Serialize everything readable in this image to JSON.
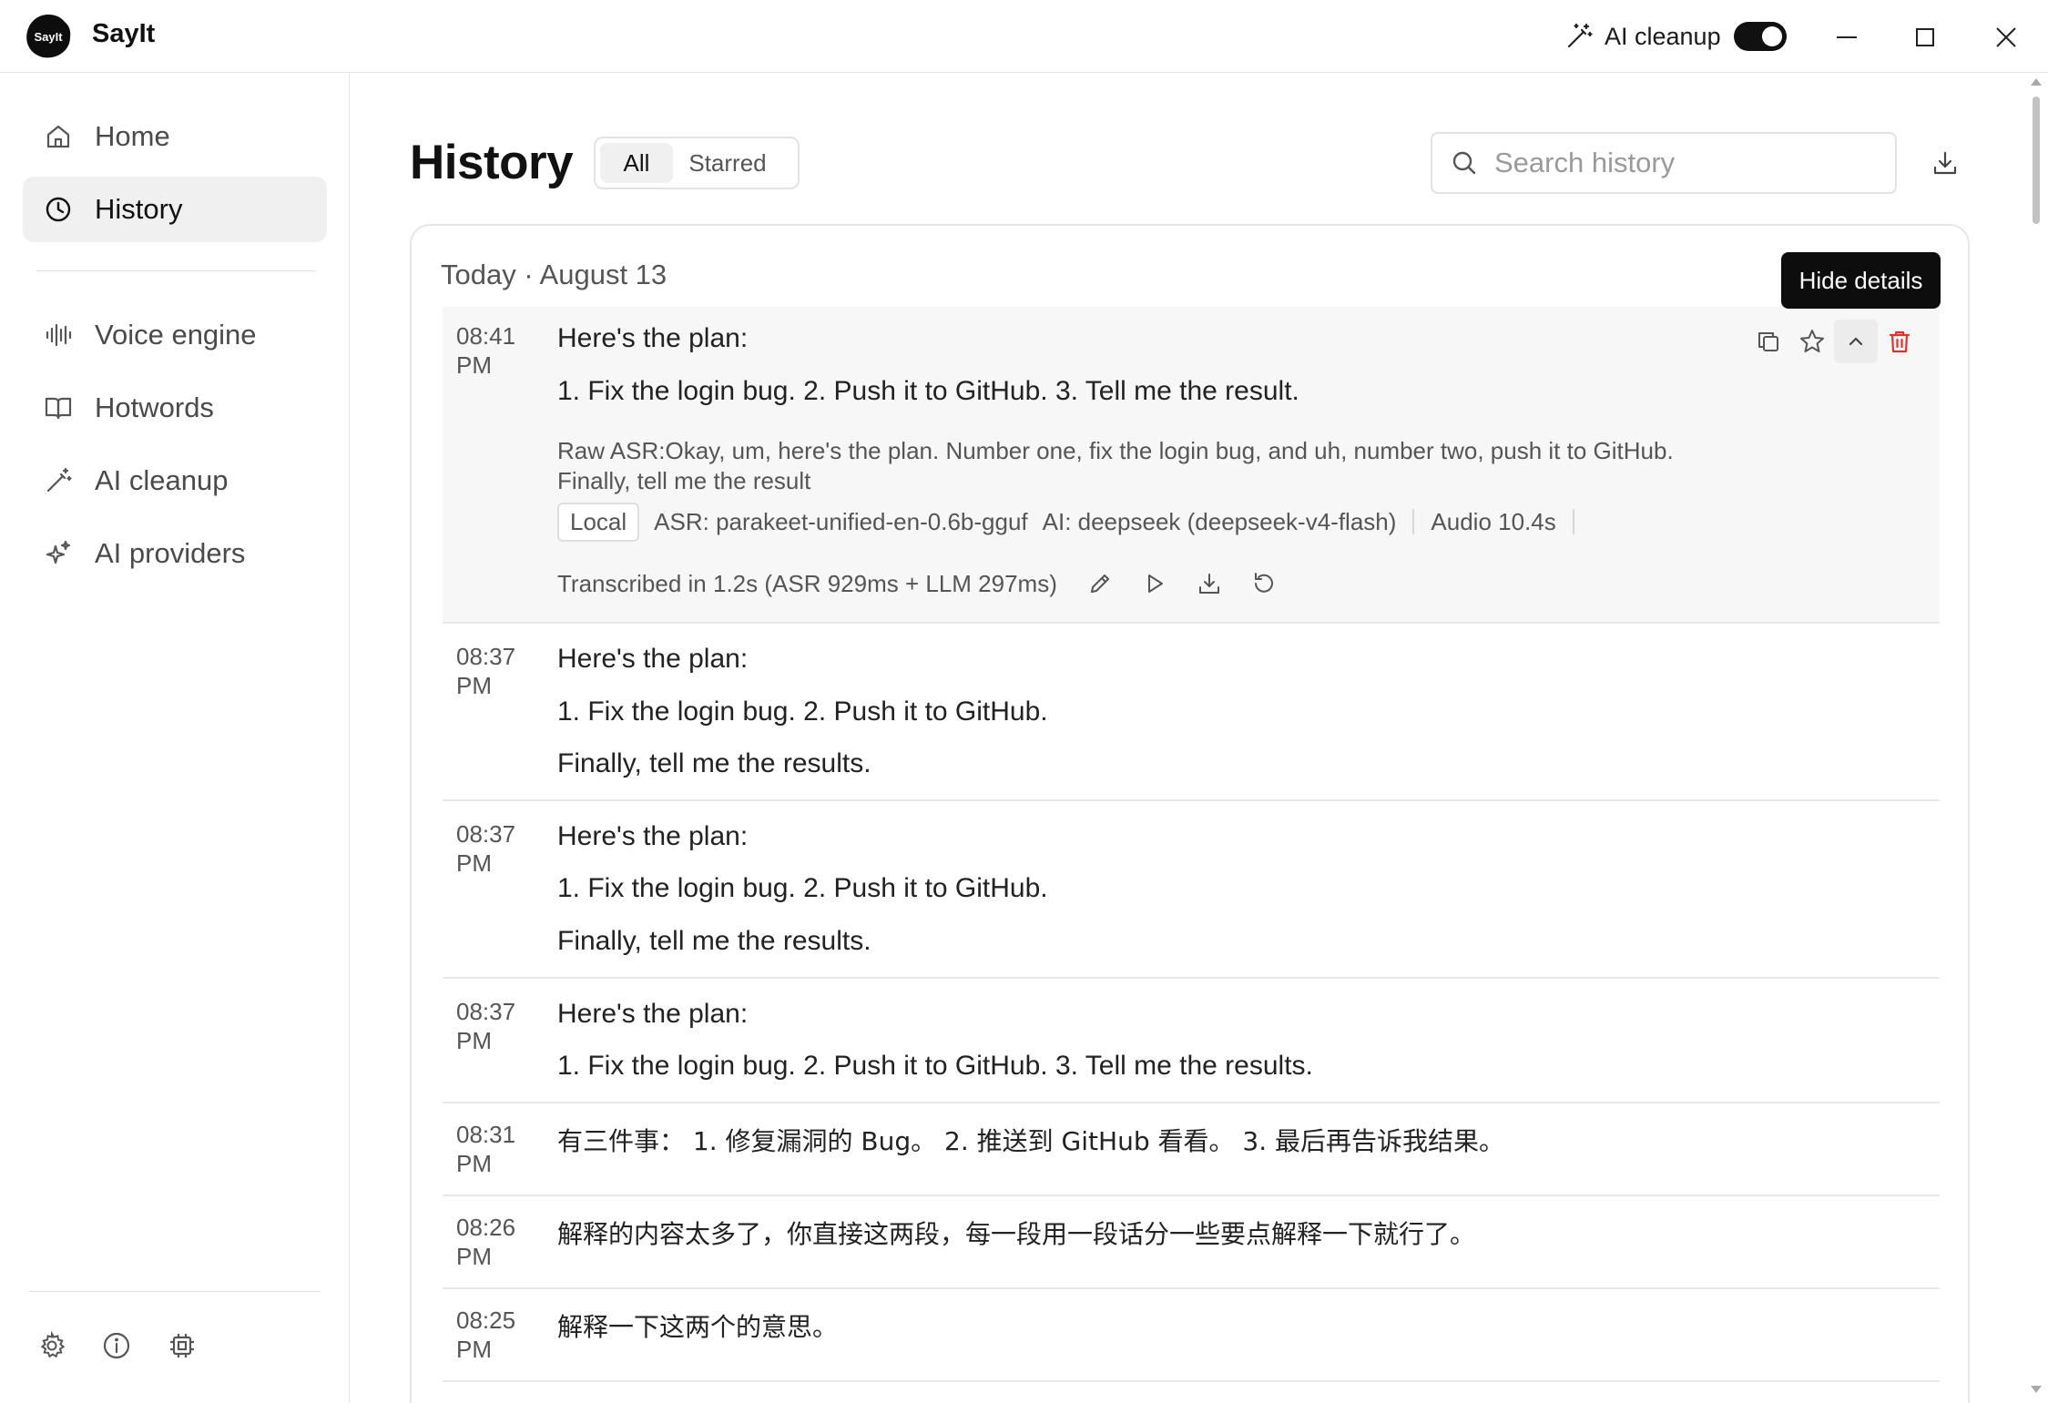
{
  "app": {
    "logo_text": "SayIt",
    "name": "SayIt"
  },
  "titlebar": {
    "ai_cleanup_label": "AI cleanup",
    "ai_cleanup_enabled": true,
    "icons": [
      "wand-icon",
      "minimize-icon",
      "maximize-icon",
      "close-icon"
    ]
  },
  "sidebar": {
    "items": [
      {
        "label": "Home",
        "icon": "home-icon",
        "active": false
      },
      {
        "label": "History",
        "icon": "clock-icon",
        "active": true
      },
      {
        "label": "Voice engine",
        "icon": "waveform-icon",
        "active": false
      },
      {
        "label": "Hotwords",
        "icon": "book-icon",
        "active": false
      },
      {
        "label": "AI cleanup",
        "icon": "wand-icon",
        "active": false
      },
      {
        "label": "AI providers",
        "icon": "sparkles-icon",
        "active": false
      }
    ],
    "footer_icons": [
      "settings-icon",
      "info-icon",
      "chip-icon"
    ]
  },
  "main": {
    "title": "History",
    "filters": [
      {
        "label": "All",
        "selected": true
      },
      {
        "label": "Starred",
        "selected": false
      }
    ],
    "search": {
      "placeholder": "Search history",
      "value": ""
    },
    "tooltip": "Hide details",
    "group_title": "Today · August 13",
    "entries": [
      {
        "time": "08:41",
        "ampm": "PM",
        "lines": [
          "Here's the plan:",
          "1. Fix the login bug. 2. Push it to GitHub. 3. Tell me the result."
        ],
        "raw_asr": "Raw ASR:Okay, um, here's the plan. Number one, fix the login bug, and uh, number two, push it to GitHub. Finally, tell me the result",
        "meta": {
          "chip": "Local",
          "asr": "ASR: parakeet-unified-en-0.6b-gguf",
          "ai": "AI: deepseek (deepseek-v4-flash)",
          "audio": "Audio 10.4s"
        },
        "timing": "Transcribed in 1.2s (ASR 929ms + LLM 297ms)"
      },
      {
        "time": "08:37",
        "ampm": "PM",
        "lines": [
          "Here's the plan:",
          "1. Fix the login bug. 2. Push it to GitHub.",
          "Finally, tell me the results."
        ]
      },
      {
        "time": "08:37",
        "ampm": "PM",
        "lines": [
          "Here's the plan:",
          "1. Fix the login bug. 2. Push it to GitHub.",
          "Finally, tell me the results."
        ]
      },
      {
        "time": "08:37",
        "ampm": "PM",
        "lines": [
          "Here's the plan:",
          "1. Fix the login bug. 2. Push it to GitHub. 3. Tell me the results."
        ]
      },
      {
        "time": "08:31",
        "ampm": "PM",
        "lines": [
          "有三件事： 1. 修复漏洞的 Bug。 2. 推送到 GitHub 看看。 3. 最后再告诉我结果。"
        ]
      },
      {
        "time": "08:26",
        "ampm": "PM",
        "lines": [
          "解释的内容太多了，你直接这两段，每一段用一段话分一些要点解释一下就行了。"
        ]
      },
      {
        "time": "08:25",
        "ampm": "PM",
        "lines": [
          "解释一下这两个的意思。"
        ]
      }
    ]
  },
  "colors": {
    "accent": "#111111",
    "delete": "#e03131",
    "active_nav_bg": "#f0f0f0",
    "expanded_bg": "#f7f7f7"
  }
}
